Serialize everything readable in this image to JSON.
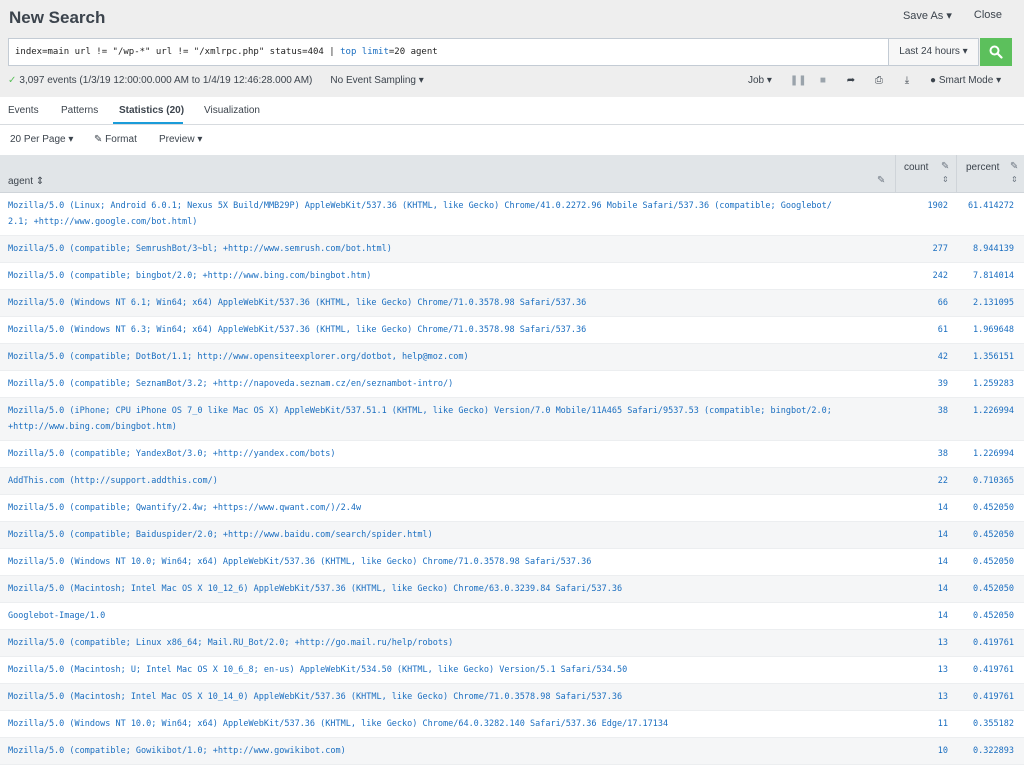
{
  "header": {
    "title": "New Search",
    "save_as": "Save As ▾",
    "close": "Close"
  },
  "search": {
    "query_part1": "index=main url != \"/wp-*\" url != \"/xmlrpc.php\" status=404 | ",
    "query_cmd": "top",
    "query_space": " ",
    "query_arg": "limit",
    "query_rest": "=20 agent",
    "time_range": "Last 24 hours ▾"
  },
  "status": {
    "events": "3,097 events (1/3/19 12:00:00.000 AM to 1/4/19 12:46:28.000 AM)",
    "sampling": "No Event Sampling ▾",
    "job": "Job ▾",
    "smart_mode": "Smart Mode ▾"
  },
  "tabs": [
    {
      "label": "Events"
    },
    {
      "label": "Patterns"
    },
    {
      "label": "Statistics (20)"
    },
    {
      "label": "Visualization"
    }
  ],
  "toolbar": {
    "per_page": "20 Per Page ▾",
    "format": "Format",
    "preview": "Preview ▾"
  },
  "table": {
    "columns": [
      "agent",
      "count",
      "percent"
    ],
    "rows": [
      {
        "agent": "Mozilla/5.0 (Linux; Android 6.0.1; Nexus 5X Build/MMB29P) AppleWebKit/537.36 (KHTML, like Gecko) Chrome/41.0.2272.96 Mobile Safari/537.36 (compatible; Googlebot/2.1; +http://www.google.com/bot.html)",
        "count": "1902",
        "percent": "61.414272"
      },
      {
        "agent": "Mozilla/5.0 (compatible; SemrushBot/3~bl; +http://www.semrush.com/bot.html)",
        "count": "277",
        "percent": "8.944139"
      },
      {
        "agent": "Mozilla/5.0 (compatible; bingbot/2.0; +http://www.bing.com/bingbot.htm)",
        "count": "242",
        "percent": "7.814014"
      },
      {
        "agent": "Mozilla/5.0 (Windows NT 6.1; Win64; x64) AppleWebKit/537.36 (KHTML, like Gecko) Chrome/71.0.3578.98 Safari/537.36",
        "count": "66",
        "percent": "2.131095"
      },
      {
        "agent": "Mozilla/5.0 (Windows NT 6.3; Win64; x64) AppleWebKit/537.36 (KHTML, like Gecko) Chrome/71.0.3578.98 Safari/537.36",
        "count": "61",
        "percent": "1.969648"
      },
      {
        "agent": "Mozilla/5.0 (compatible; DotBot/1.1; http://www.opensiteexplorer.org/dotbot, help@moz.com)",
        "count": "42",
        "percent": "1.356151"
      },
      {
        "agent": "Mozilla/5.0 (compatible; SeznamBot/3.2; +http://napoveda.seznam.cz/en/seznambot-intro/)",
        "count": "39",
        "percent": "1.259283"
      },
      {
        "agent": "Mozilla/5.0 (iPhone; CPU iPhone OS 7_0 like Mac OS X) AppleWebKit/537.51.1 (KHTML, like Gecko) Version/7.0 Mobile/11A465 Safari/9537.53 (compatible; bingbot/2.0; +http://www.bing.com/bingbot.htm)",
        "count": "38",
        "percent": "1.226994"
      },
      {
        "agent": "Mozilla/5.0 (compatible; YandexBot/3.0; +http://yandex.com/bots)",
        "count": "38",
        "percent": "1.226994"
      },
      {
        "agent": "AddThis.com (http://support.addthis.com/)",
        "count": "22",
        "percent": "0.710365"
      },
      {
        "agent": "Mozilla/5.0 (compatible; Qwantify/2.4w; +https://www.qwant.com/)/2.4w",
        "count": "14",
        "percent": "0.452050"
      },
      {
        "agent": "Mozilla/5.0 (compatible; Baiduspider/2.0; +http://www.baidu.com/search/spider.html)",
        "count": "14",
        "percent": "0.452050"
      },
      {
        "agent": "Mozilla/5.0 (Windows NT 10.0; Win64; x64) AppleWebKit/537.36 (KHTML, like Gecko) Chrome/71.0.3578.98 Safari/537.36",
        "count": "14",
        "percent": "0.452050"
      },
      {
        "agent": "Mozilla/5.0 (Macintosh; Intel Mac OS X 10_12_6) AppleWebKit/537.36 (KHTML, like Gecko) Chrome/63.0.3239.84 Safari/537.36",
        "count": "14",
        "percent": "0.452050"
      },
      {
        "agent": "Googlebot-Image/1.0",
        "count": "14",
        "percent": "0.452050"
      },
      {
        "agent": "Mozilla/5.0 (compatible; Linux x86_64; Mail.RU_Bot/2.0; +http://go.mail.ru/help/robots)",
        "count": "13",
        "percent": "0.419761"
      },
      {
        "agent": "Mozilla/5.0 (Macintosh; U; Intel Mac OS X 10_6_8; en-us) AppleWebKit/534.50 (KHTML, like Gecko) Version/5.1 Safari/534.50",
        "count": "13",
        "percent": "0.419761"
      },
      {
        "agent": "Mozilla/5.0 (Macintosh; Intel Mac OS X 10_14_0) AppleWebKit/537.36 (KHTML, like Gecko) Chrome/71.0.3578.98 Safari/537.36",
        "count": "13",
        "percent": "0.419761"
      },
      {
        "agent": "Mozilla/5.0 (Windows NT 10.0; Win64; x64) AppleWebKit/537.36 (KHTML, like Gecko) Chrome/64.0.3282.140 Safari/537.36 Edge/17.17134",
        "count": "11",
        "percent": "0.355182"
      },
      {
        "agent": "Mozilla/5.0 (compatible; Gowikibot/1.0; +http://www.gowikibot.com)",
        "count": "10",
        "percent": "0.322893"
      }
    ]
  },
  "icons": {
    "search": "search-icon",
    "pause": "pause-icon",
    "stop": "stop-icon",
    "share": "share-icon",
    "print": "print-icon",
    "export": "export-icon",
    "smart_mode": "lightbulb-icon",
    "format": "pencil-icon",
    "sort": "sort-icon"
  },
  "colors": {
    "accent_green": "#5cc05c",
    "link_blue": "#1a6ec0",
    "tab_underline": "#1a9cd9"
  }
}
